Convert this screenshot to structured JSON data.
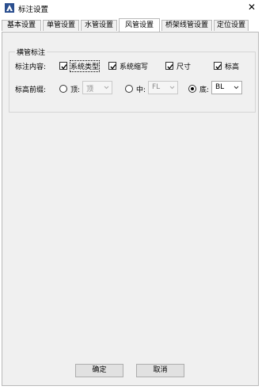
{
  "window": {
    "title": "标注设置",
    "close_glyph": "✕",
    "icon": "app-logo-icon"
  },
  "tabs": [
    {
      "label": "基本设置"
    },
    {
      "label": "单管设置"
    },
    {
      "label": "水管设置"
    },
    {
      "label": "风管设置"
    },
    {
      "label": "桥架线管设置"
    },
    {
      "label": "定位设置"
    }
  ],
  "active_tab": "风管设置",
  "group": {
    "title": "横管标注",
    "content_label": "标注内容:",
    "checkboxes": [
      {
        "label": "系统类型",
        "checked": true
      },
      {
        "label": "系统缩写",
        "checked": true
      },
      {
        "label": "尺寸",
        "checked": true
      },
      {
        "label": "标高",
        "checked": true
      }
    ],
    "prefix_label": "标高前缀:",
    "radios": [
      {
        "label": "顶:",
        "selected": false,
        "combo_value": "顶",
        "enabled": false
      },
      {
        "label": "中:",
        "selected": false,
        "combo_value": "FL",
        "enabled": false
      },
      {
        "label": "底:",
        "selected": true,
        "combo_value": "BL",
        "enabled": true
      }
    ]
  },
  "buttons": {
    "ok": "确定",
    "cancel": "取消"
  }
}
